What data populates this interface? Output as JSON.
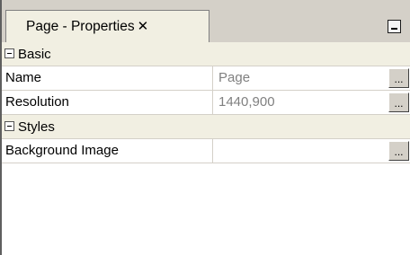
{
  "tab": {
    "title": "Page - Properties",
    "close_glyph": "✕"
  },
  "grid": {
    "categories": [
      {
        "label": "Basic",
        "properties": [
          {
            "name": "Name",
            "value": "Page",
            "button": "..."
          },
          {
            "name": "Resolution",
            "value": "1440,900",
            "button": "..."
          }
        ]
      },
      {
        "label": "Styles",
        "properties": [
          {
            "name": "Background Image",
            "value": "",
            "button": "..."
          }
        ]
      }
    ]
  },
  "colors": {
    "tabbar": "#d4d0c8",
    "tab": "#f1efe2",
    "category": "#f1efe2",
    "value_text": "#808080"
  },
  "icons": {
    "minimize": "minimize-icon",
    "expander": "collapse-minus-icon"
  }
}
